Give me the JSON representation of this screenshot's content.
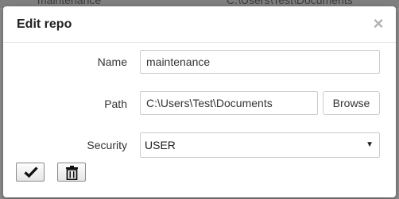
{
  "background_row": {
    "cell1": "maintenance",
    "cell2": "C:\\Users\\Test\\Documents"
  },
  "dialog": {
    "title": "Edit repo",
    "close_icon": "close-icon",
    "fields": {
      "name": {
        "label": "Name",
        "value": "maintenance"
      },
      "path": {
        "label": "Path",
        "value": "C:\\Users\\Test\\Documents",
        "browse_label": "Browse"
      },
      "security": {
        "label": "Security",
        "value": "USER"
      }
    },
    "actions": {
      "confirm_icon": "checkmark-icon",
      "delete_icon": "trash-icon"
    }
  },
  "colors": {
    "backdrop": "#8c8c8c",
    "close": "#b3b3b3",
    "border": "#cccccc"
  }
}
